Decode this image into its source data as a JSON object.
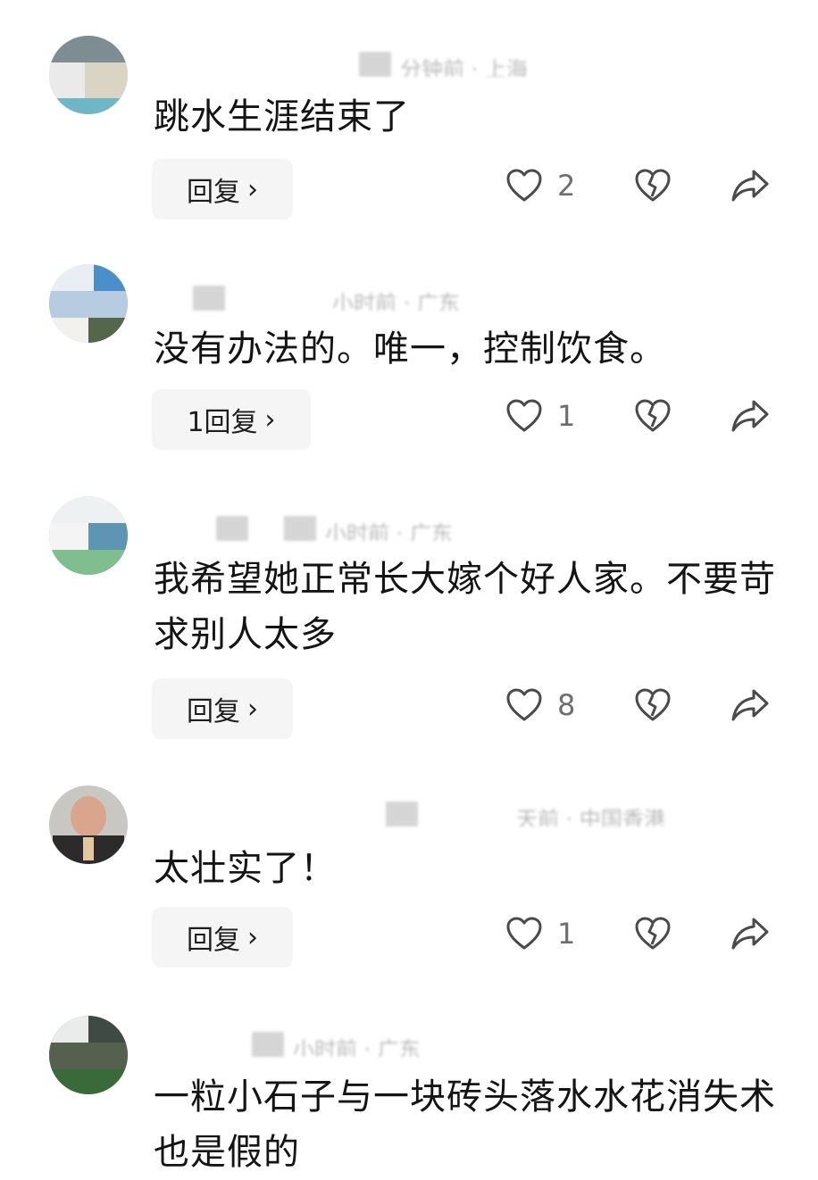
{
  "comments": [
    {
      "meta": "分钟前 · 上海",
      "text": "跳水生涯结束了",
      "reply_label": "回复",
      "likes": "2"
    },
    {
      "meta": "小时前 · 广东",
      "text": "没有办法的。唯一，控制饮食。",
      "reply_label": "1回复",
      "likes": "1"
    },
    {
      "meta": "小时前 · 广东",
      "text": "我希望她正常长大嫁个好人家。不要苛求别人太多",
      "reply_label": "回复",
      "likes": "8"
    },
    {
      "meta": "天前 · 中国香港",
      "text": "太壮实了！",
      "reply_label": "回复",
      "likes": "1"
    },
    {
      "meta": "小时前 · 广东",
      "text": "一粒小石子与一块砖头落水水花消失术也是假的",
      "reply_label": "",
      "likes": ""
    }
  ],
  "icons": {
    "like": "heart-outline-icon",
    "dislike": "broken-heart-icon",
    "share": "share-arrow-icon",
    "chevron": "chevron-right-icon"
  },
  "colors": {
    "text": "#141414",
    "muted": "#6e6e6e",
    "button_bg": "#f5f5f5",
    "icon": "#4a4a4a"
  }
}
